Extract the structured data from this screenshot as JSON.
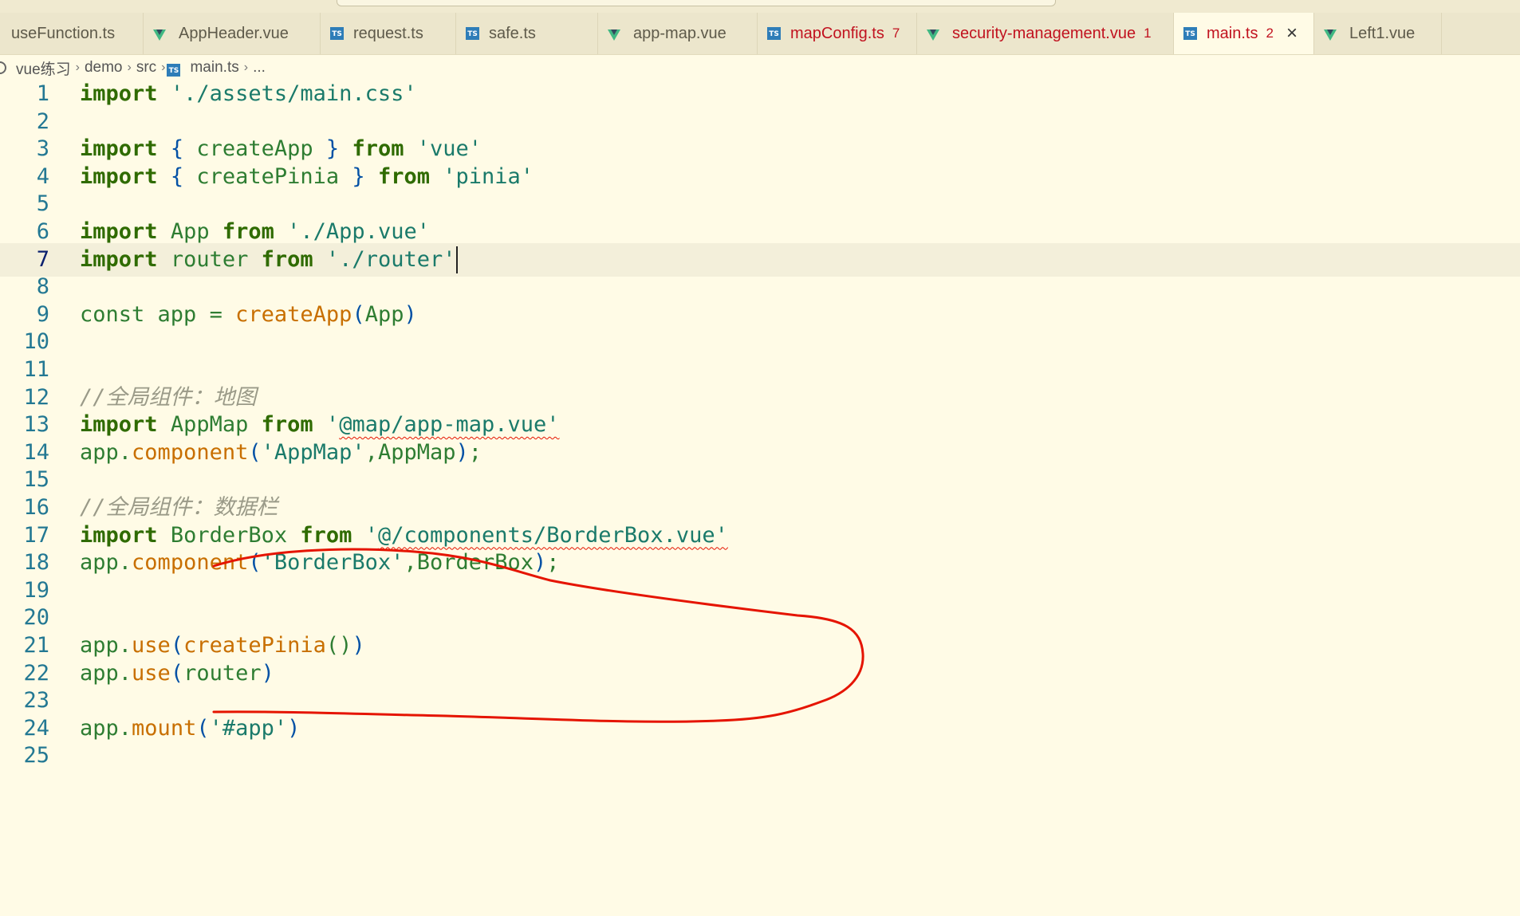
{
  "tabs": [
    {
      "label": "useFunction.ts",
      "icon": "none",
      "width": 180
    },
    {
      "label": "AppHeader.vue",
      "icon": "vue-icon",
      "width": 222
    },
    {
      "label": "request.ts",
      "icon": "ts-icon",
      "width": 170
    },
    {
      "label": "safe.ts",
      "icon": "ts-icon",
      "width": 178
    },
    {
      "label": "app-map.vue",
      "icon": "vue-icon",
      "width": 200
    },
    {
      "label": "mapConfig.ts",
      "icon": "ts-icon",
      "width": 200,
      "error": true,
      "count": "7"
    },
    {
      "label": "security-management.vue",
      "icon": "vue-icon",
      "width": 322,
      "error": true,
      "count": "1"
    },
    {
      "label": "main.ts",
      "icon": "ts-icon",
      "width": 176,
      "active": true,
      "count": "2",
      "close": "×"
    },
    {
      "label": "Left1.vue",
      "icon": "vue-icon",
      "width": 160
    }
  ],
  "breadcrumb": [
    "vue练习",
    "demo",
    "src",
    "main.ts",
    "..."
  ],
  "editor": {
    "current_line": 7,
    "lines": [
      "import './assets/main.css'",
      "",
      "import { createApp } from 'vue'",
      "import { createPinia } from 'pinia'",
      "",
      "import App from './App.vue'",
      "import router from './router'",
      "",
      "const app = createApp(App)",
      "",
      "",
      "//全局组件：地图",
      "import AppMap from '@map/app-map.vue'",
      "app.component('AppMap',AppMap);",
      "",
      "//全局组件：数据栏",
      "import BorderBox from '@/components/BorderBox.vue'",
      "app.component('BorderBox',BorderBox);",
      "",
      "",
      "app.use(createPinia())",
      "app.use(router)",
      "",
      "app.mount('#app')",
      ""
    ]
  },
  "colors": {
    "background": "#fffbe6",
    "keyword": "#2f6b00",
    "function": "#c86f00",
    "string": "#1a7a6a",
    "line_number": "#237893",
    "error": "#c1121f",
    "annotation": "#e51400"
  }
}
